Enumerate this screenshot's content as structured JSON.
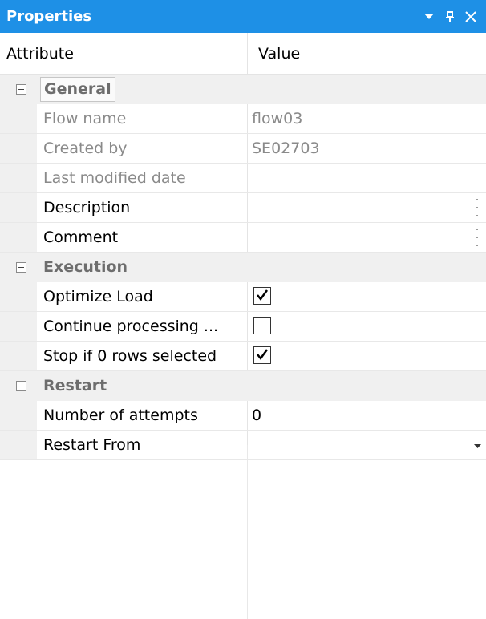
{
  "panel": {
    "title": "Properties",
    "controls": {
      "dropdown_icon": "triangle-down",
      "pin_icon": "pin",
      "close_icon": "close"
    }
  },
  "header": {
    "attribute": "Attribute",
    "value": "Value"
  },
  "categories": {
    "general": {
      "label": "General",
      "rows": {
        "flow_name": {
          "label": "Flow name",
          "value": "flow03"
        },
        "created_by": {
          "label": "Created by",
          "value": "SE02703"
        },
        "last_modified": {
          "label": "Last modified date",
          "value": ""
        },
        "description": {
          "label": "Description",
          "value": ""
        },
        "comment": {
          "label": "Comment",
          "value": ""
        }
      }
    },
    "execution": {
      "label": "Execution",
      "rows": {
        "optimize_load": {
          "label": "Optimize Load",
          "checked": true
        },
        "continue_processing": {
          "label": "Continue processing ...",
          "checked": false
        },
        "stop_if_zero": {
          "label": "Stop if 0 rows selected",
          "checked": true
        }
      }
    },
    "restart": {
      "label": "Restart",
      "rows": {
        "attempts": {
          "label": "Number of attempts",
          "value": "0"
        },
        "restart_from": {
          "label": "Restart From",
          "value": ""
        }
      }
    }
  },
  "colors": {
    "titlebar": "#1e90e6",
    "gutter": "#f0f0f0",
    "readonly_text": "#8a8a8a"
  }
}
